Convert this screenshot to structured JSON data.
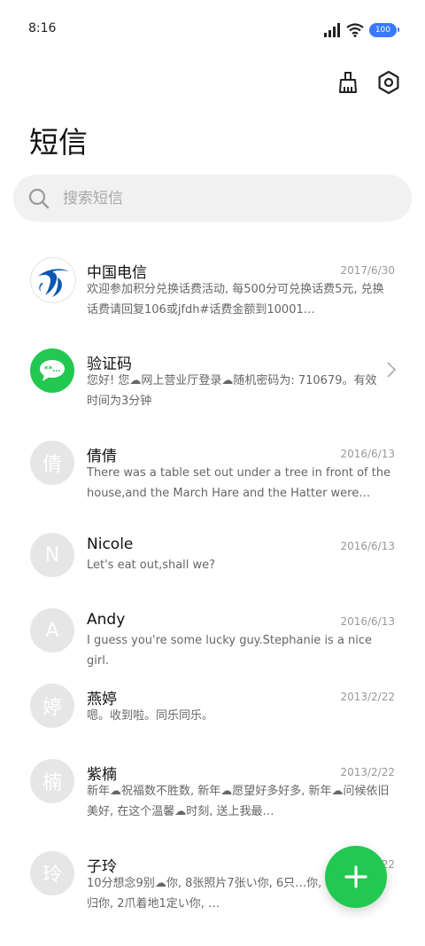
{
  "status": {
    "time": "8:16",
    "battery": "100"
  },
  "header": {
    "title": "短信"
  },
  "search": {
    "placeholder": "搜索短信"
  },
  "messages": [
    {
      "name": "中国电信",
      "date": "2017/6/30",
      "preview": "欢迎参加积分兑换话费活动, 每500分可兑换话费5元, 兑换话费请回复106或jfdh#话费金额到10001…",
      "avatar": "china-telecom-logo"
    },
    {
      "name": "验证码",
      "date": "",
      "preview": "您好! 您☁网上营业厅登录☁随机密码为: 710679。有效时间为3分钟",
      "avatar": "message-bubble-icon"
    },
    {
      "name": "倩倩",
      "date": "2016/6/13",
      "preview": "There was a table set out under a tree in front of the house,and the March Hare and the Hatter were having t…",
      "avatar_letter": "倩"
    },
    {
      "name": "Nicole",
      "date": "2016/6/13",
      "preview": "Let's eat out,shall we?",
      "avatar_letter": "N"
    },
    {
      "name": "Andy",
      "date": "2016/6/13",
      "preview": "I guess you're some lucky guy.Stephanie is a nice girl.",
      "avatar_letter": "A"
    },
    {
      "name": "燕婷",
      "date": "2013/2/22",
      "preview": "嗯。收到啦。同乐同乐。",
      "avatar_letter": "婷"
    },
    {
      "name": "紫楠",
      "date": "2013/2/22",
      "preview": "新年☁祝福数不胜数, 新年☁愿望好多好多, 新年☁问候依旧美好, 在这个温馨☁时刻, 送上我最…",
      "avatar_letter": "楠"
    },
    {
      "name": "子玲",
      "date": "2013/2/22",
      "preview": "10分想念9别☁你, 8张照片7张い你, 6只…你, 4根骨头3根归你, 2爪着地1定い你, …",
      "avatar_letter": "玲"
    }
  ],
  "colors": {
    "accent": "#22c84f",
    "battery": "#3a7afe"
  }
}
